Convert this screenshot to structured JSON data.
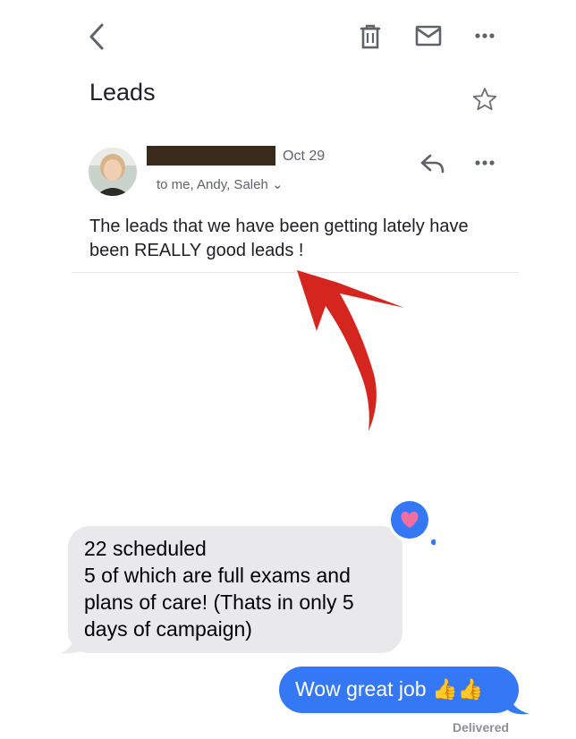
{
  "email": {
    "subject": "Leads",
    "date": "Oct 29",
    "recipients": "to me, Andy, Saleh ⌄",
    "body": "The leads that we have been getting lately have been REALLY good leads !"
  },
  "icons": {
    "back": "chevron-left-icon",
    "trash": "trash-icon",
    "mail": "mail-icon",
    "more": "more-horizontal-icon",
    "star": "star-outline-icon",
    "reply": "reply-icon",
    "avatar": "sender-avatar",
    "tapback": "heart-tapback-icon"
  },
  "colors": {
    "annotation_arrow": "#d4261f",
    "outgoing_bubble": "#3478f6",
    "incoming_bubble": "#e9e9eb",
    "tapback": "#3478f6",
    "heart": "#f06fa0"
  },
  "messages": {
    "incoming": "22 scheduled\n5 of which are full exams and plans of care! (Thats in only 5 days of campaign)",
    "outgoing": "Wow great job 👍👍",
    "status": "Delivered"
  }
}
